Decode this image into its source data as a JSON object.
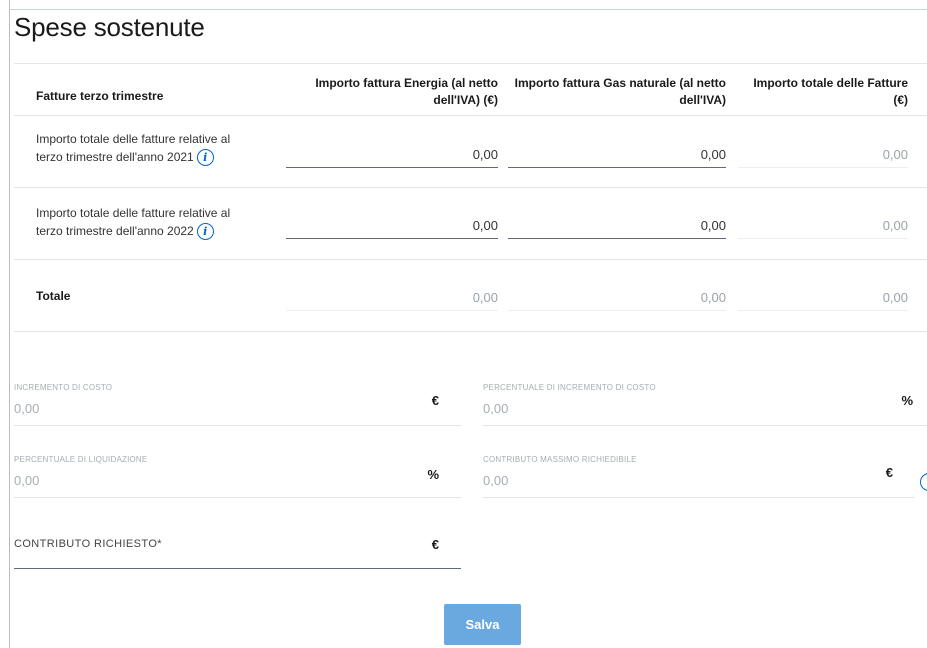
{
  "page": {
    "title": "Spese sostenute"
  },
  "table": {
    "headers": {
      "label": "Fatture terzo trimestre",
      "energia_line1": "Importo fattura Energia (al netto",
      "energia_line2": "dell'IVA) (€)",
      "gas_line1": "Importo fattura Gas naturale (al netto",
      "gas_line2": "dell'IVA)",
      "totale_line1": "Importo totale delle Fatture",
      "totale_line2": "(€)"
    },
    "rows": [
      {
        "label_line1": "Importo totale delle fatture relative al",
        "label_line2": "terzo trimestre dell'anno 2021",
        "energia": "0,00",
        "gas": "0,00",
        "totale": "0,00"
      },
      {
        "label_line1": "Importo totale delle fatture relative al",
        "label_line2": "terzo trimestre dell'anno 2022",
        "energia": "0,00",
        "gas": "0,00",
        "totale": "0,00"
      }
    ],
    "total_row": {
      "label": "Totale",
      "energia": "0,00",
      "gas": "0,00",
      "totale": "0,00"
    }
  },
  "info_icon_glyph": "i",
  "fields": {
    "incremento_costo": {
      "label": "INCREMENTO DI COSTO",
      "value": "0,00",
      "unit": "€"
    },
    "percentuale_incremento": {
      "label": "PERCENTUALE DI INCREMENTO DI COSTO",
      "value": "0,00",
      "unit": "%"
    },
    "percentuale_liquidazione": {
      "label": "PERCENTUALE DI LIQUIDAZIONE",
      "value": "0,00",
      "unit": "%"
    },
    "contributo_massimo": {
      "label": "CONTRIBUTO MASSIMO RICHIEDIBILE",
      "value": "0,00",
      "unit": "€"
    },
    "contributo_richiesto": {
      "label": "CONTRIBUTO RICHIESTO*",
      "unit": "€"
    }
  },
  "actions": {
    "save_label": "Salva"
  },
  "colors": {
    "accent": "#0066cc",
    "button": "#6aa8e0"
  }
}
